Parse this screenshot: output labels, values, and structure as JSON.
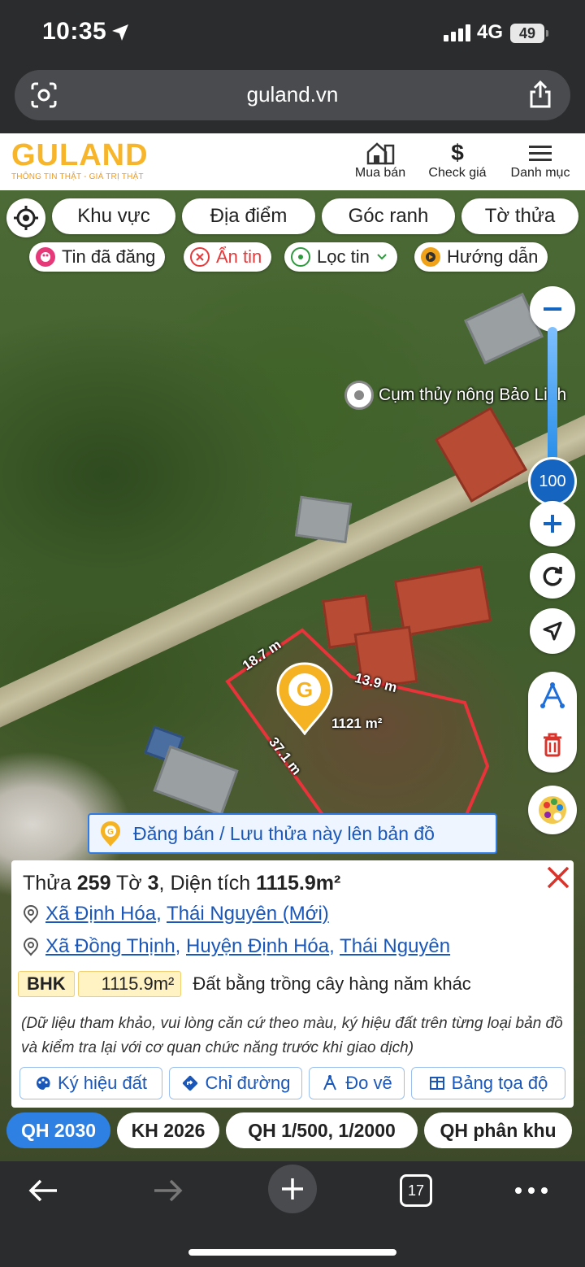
{
  "status_bar": {
    "time": "10:35",
    "network": "4G",
    "battery": "49"
  },
  "browser": {
    "url": "guland.vn",
    "tabs_count": "17"
  },
  "header": {
    "logo": "GULAND",
    "tagline": "THÔNG TIN THẬT - GIÁ TRỊ THẬT",
    "nav": [
      {
        "label": "Mua bán",
        "icon": "house-icon"
      },
      {
        "label": "Check giá",
        "icon": "dollar-icon"
      },
      {
        "label": "Danh mục",
        "icon": "menu-icon"
      }
    ]
  },
  "map_tabs": [
    "Khu vực",
    "Địa điểm",
    "Góc ranh",
    "Tờ thửa"
  ],
  "map_pills": [
    {
      "label": "Tin đã đăng",
      "icon": "palette-icon"
    },
    {
      "label": "Ẩn tin",
      "icon": "close-circle-icon"
    },
    {
      "label": "Lọc tin",
      "icon": "pin-icon"
    },
    {
      "label": "Hướng dẫn",
      "icon": "play-icon"
    }
  ],
  "map": {
    "poi_label": "Cụm thủy nông Bảo Linh",
    "zoom_level": "100",
    "parcel": {
      "edge_top": "18.7 m",
      "edge_right": "13.9 m",
      "edge_left": "37.1 m",
      "area": "1121 m²"
    },
    "save_banner": "Đăng bán / Lưu thửa này lên bản đồ"
  },
  "parcel_info": {
    "title_prefix": "Thửa",
    "parcel_no": "259",
    "sheet_label": "Tờ",
    "sheet_no": "3",
    "area_label": "Diện tích",
    "area_value": "1115.9m²",
    "address_new": {
      "commune": "Xã Định Hóa",
      "province": "Thái Nguyên (Mới)"
    },
    "address_old": {
      "commune": "Xã Đồng Thịnh",
      "district": "Huyện Định Hóa",
      "province": "Thái Nguyên"
    },
    "land_code": "BHK",
    "land_area": "1115.9m²",
    "land_type": "Đất bằng trồng cây hàng năm khác",
    "note": "(Dữ liệu tham khảo, vui lòng căn cứ theo màu, ký hiệu đất trên từng loại bản đồ và kiểm tra lại với cơ quan chức năng trước khi giao dịch)",
    "actions": [
      "Ký hiệu đất",
      "Chỉ đường",
      "Đo vẽ",
      "Bảng tọa độ"
    ]
  },
  "layer_tabs": [
    "QH 2030",
    "KH 2026",
    "QH 1/500, 1/2000",
    "QH phân khu"
  ],
  "colors": {
    "brand": "#f7b52c",
    "link": "#1a57b8",
    "active_tab": "#2f80e3",
    "parcel_outline": "#e8333a"
  }
}
